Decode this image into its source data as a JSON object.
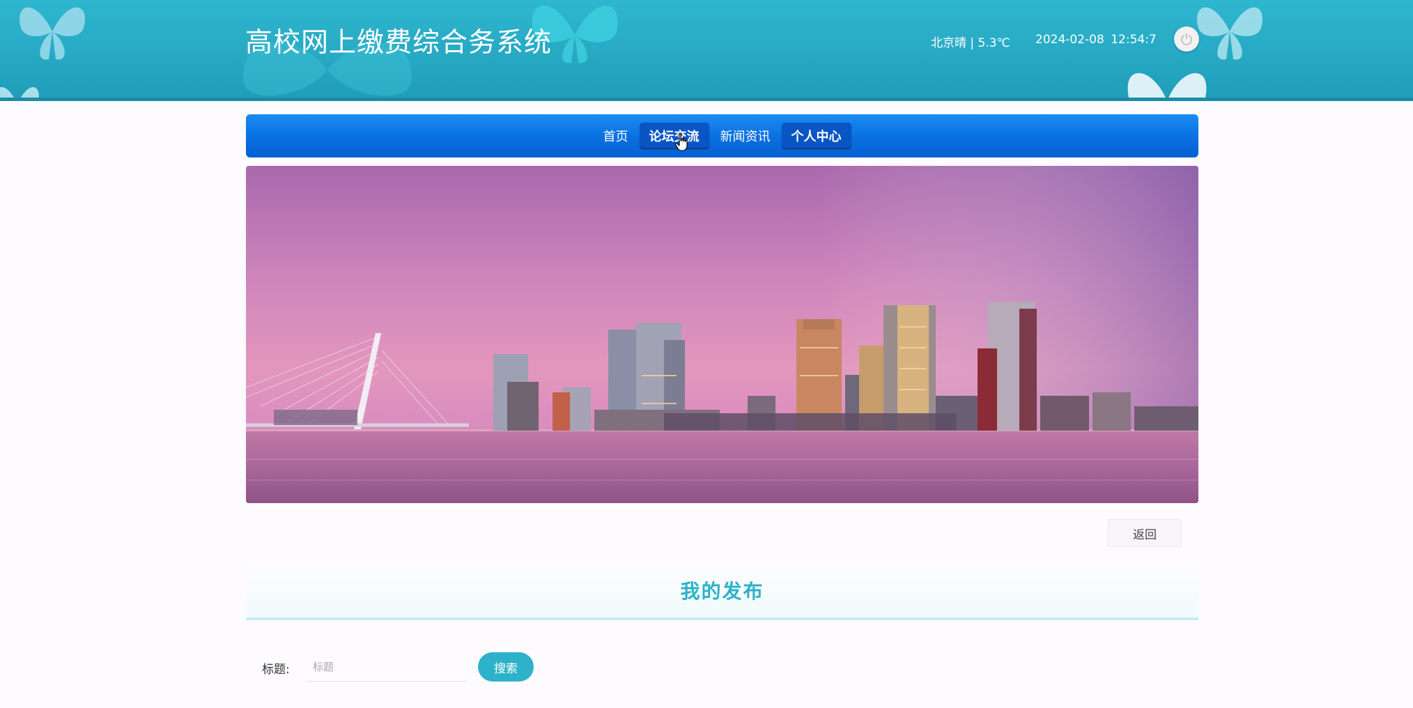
{
  "header": {
    "title": "高校网上缴费综合务系统",
    "weather": "北京晴 | 5.3℃",
    "date": "2024-02-08",
    "time": "12:54:7",
    "power_icon": "power-icon"
  },
  "nav": {
    "items": [
      {
        "label": "首页",
        "active": false
      },
      {
        "label": "论坛交流",
        "active": true
      },
      {
        "label": "新闻资讯",
        "active": false
      },
      {
        "label": "个人中心",
        "active": true
      }
    ]
  },
  "banner": {
    "description_icon": "city-skyline-image"
  },
  "actions": {
    "back_label": "返回"
  },
  "section": {
    "title": "我的发布"
  },
  "search": {
    "label": "标题:",
    "placeholder": "标题",
    "button_label": "搜索"
  },
  "colors": {
    "header": "#27a9c4",
    "nav": "#0a6fe0",
    "accent": "#2db2c9"
  }
}
